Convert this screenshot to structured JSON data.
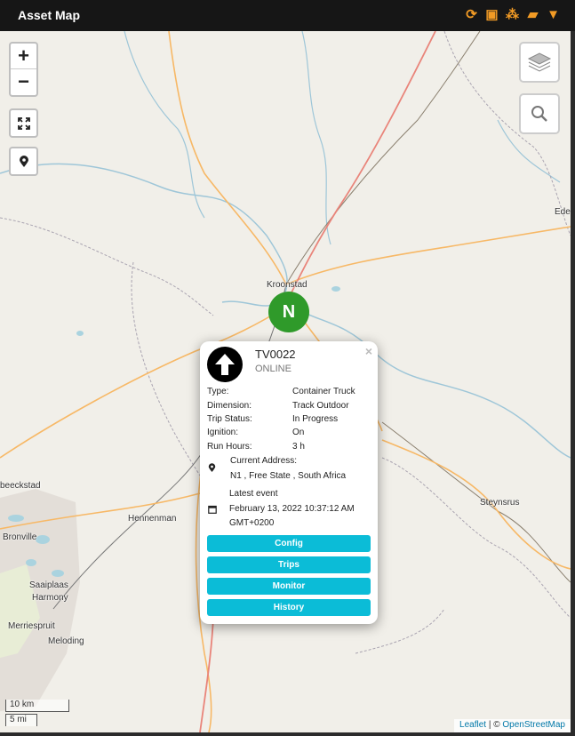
{
  "header": {
    "title": "Asset Map",
    "tools": [
      {
        "icon": "refresh-icon",
        "glyph": "⟳"
      },
      {
        "icon": "box-icon",
        "glyph": "▣"
      },
      {
        "icon": "boxes-icon",
        "glyph": "⁂"
      },
      {
        "icon": "truck-icon",
        "glyph": "▰"
      },
      {
        "icon": "filter-icon",
        "glyph": "▼"
      }
    ],
    "accent_color": "#f29b25"
  },
  "map_controls": {
    "zoom_in": "+",
    "zoom_out": "−"
  },
  "places": {
    "kroonstad": "Kroonstad",
    "hennenman": "Hennenman",
    "steynsrus": "Steynsrus",
    "bronville": "Bronville",
    "saaiplaas": "Saaiplaas",
    "harmony": "Harmony",
    "merriespruit": "Merriespruit",
    "meloding": "Meloding",
    "beeckstad": "beeckstad",
    "ede": "Ede"
  },
  "marker": {
    "label": "N",
    "color": "#2f9a2a"
  },
  "popup": {
    "asset_id": "TV0022",
    "status": "ONLINE",
    "details": [
      {
        "label": "Type:",
        "value": "Container Truck"
      },
      {
        "label": "Dimension:",
        "value": "Track Outdoor"
      },
      {
        "label": "Trip Status:",
        "value": "In Progress"
      },
      {
        "label": "Ignition:",
        "value": "On"
      },
      {
        "label": "Run Hours:",
        "value": "3 h"
      }
    ],
    "address_label": "Current Address:",
    "address_value": "N1 , Free State , South Africa",
    "event_label": "Latest event",
    "event_date": "February 13, 2022 10:37:12 AM",
    "event_tz": "GMT+0200",
    "buttons": [
      "Config",
      "Trips",
      "Monitor",
      "History"
    ],
    "button_color": "#0bbcd7",
    "close": "×"
  },
  "scale": {
    "km": "10 km",
    "mi": "5 mi"
  },
  "attribution": {
    "leaflet": "Leaflet",
    "separator": " | © ",
    "osm": "OpenStreetMap"
  }
}
